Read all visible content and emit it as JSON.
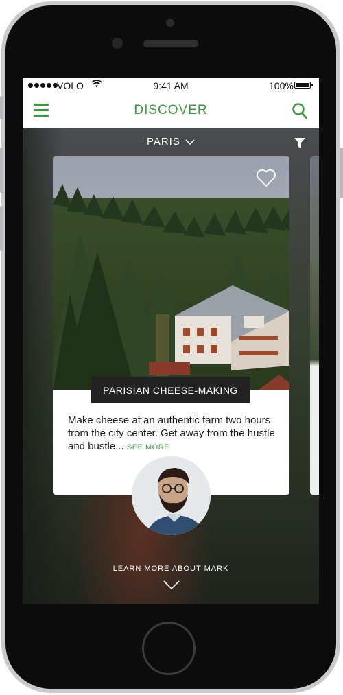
{
  "status_bar": {
    "carrier": "VOLO",
    "time": "9:41 AM",
    "battery": "100%"
  },
  "nav": {
    "title": "DISCOVER",
    "menu_icon": "hamburger-icon",
    "search_icon": "search-icon"
  },
  "location": {
    "city": "PARIS"
  },
  "card": {
    "label": "PARISIAN CHEESE-MAKING",
    "description": "Make cheese at an authentic farm two hours from the city center. Get away from the hustle and bustle...",
    "see_more": "SEE MORE"
  },
  "host": {
    "learn_more": "LEARN MORE ABOUT MARK"
  },
  "colors": {
    "accent": "#3a9b3a",
    "label_bg": "#222222"
  }
}
